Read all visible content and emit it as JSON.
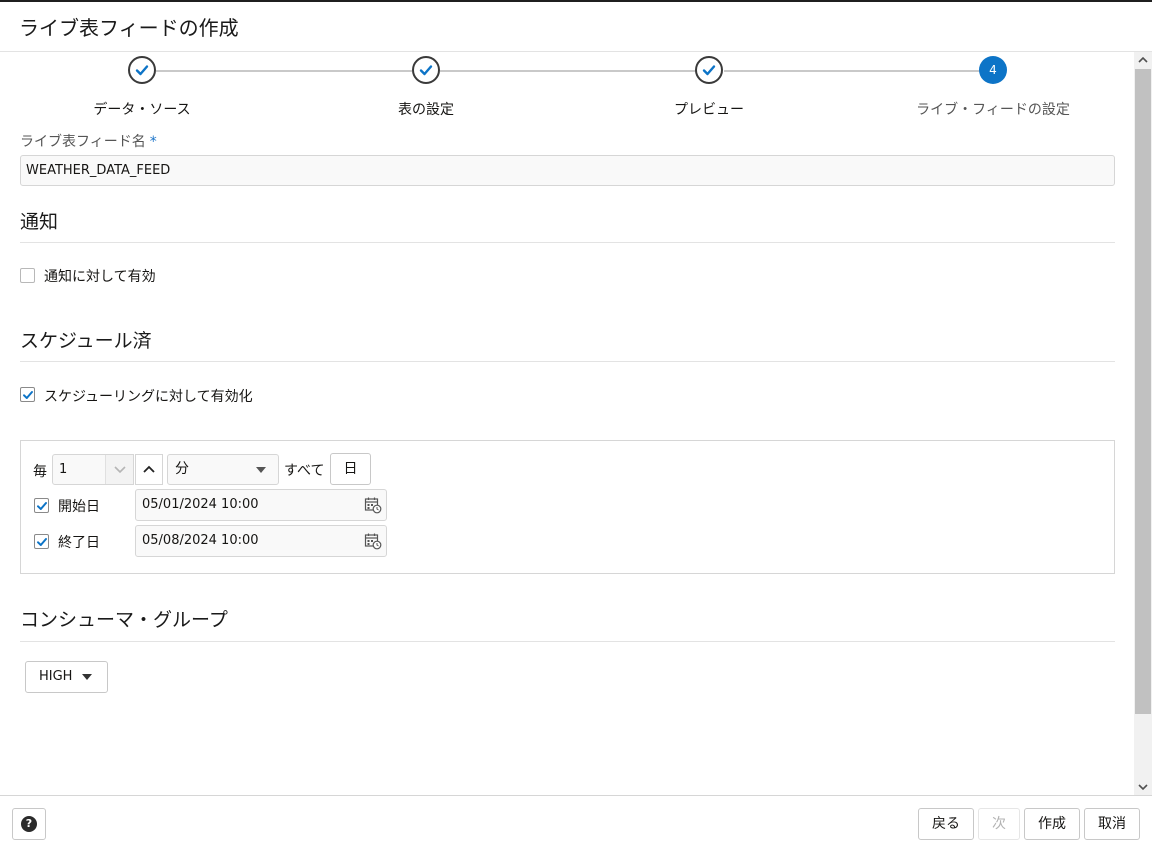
{
  "dialog": {
    "title": "ライブ表フィードの作成"
  },
  "train": {
    "steps": [
      {
        "label": "データ・ソース",
        "state": "done"
      },
      {
        "label": "表の設定",
        "state": "done"
      },
      {
        "label": "プレビュー",
        "state": "done"
      },
      {
        "label": "ライブ・フィードの設定",
        "state": "current",
        "number": "4"
      }
    ]
  },
  "feed_name": {
    "label": "ライブ表フィード名",
    "required_mark": "*",
    "value": "WEATHER_DATA_FEED"
  },
  "notification": {
    "heading": "通知",
    "checkbox_label": "通知に対して有効",
    "checked": false
  },
  "schedule": {
    "heading": "スケジュール済",
    "checkbox_label": "スケジューリングに対して有効化",
    "checked": true,
    "every_label": "毎",
    "interval_value": "1",
    "unit_value": "分",
    "all_label": "すべて",
    "day_button": "日",
    "start": {
      "label": "開始日",
      "value": "05/01/2024 10:00",
      "checked": true
    },
    "end": {
      "label": "終了日",
      "value": "05/08/2024 10:00",
      "checked": true
    }
  },
  "consumer_group": {
    "heading": "コンシューマ・グループ",
    "value": "HIGH"
  },
  "footer": {
    "help_icon": "?",
    "back_label": "戻る",
    "next_label": "次",
    "create_label": "作成",
    "cancel_label": "取消"
  },
  "colors": {
    "accent": "#0d74c7",
    "border": "#d6d6d6"
  },
  "icons": [
    "check-icon",
    "calendar-icon",
    "help-icon",
    "chevron-up-icon",
    "chevron-down-icon",
    "caret-down-icon"
  ]
}
